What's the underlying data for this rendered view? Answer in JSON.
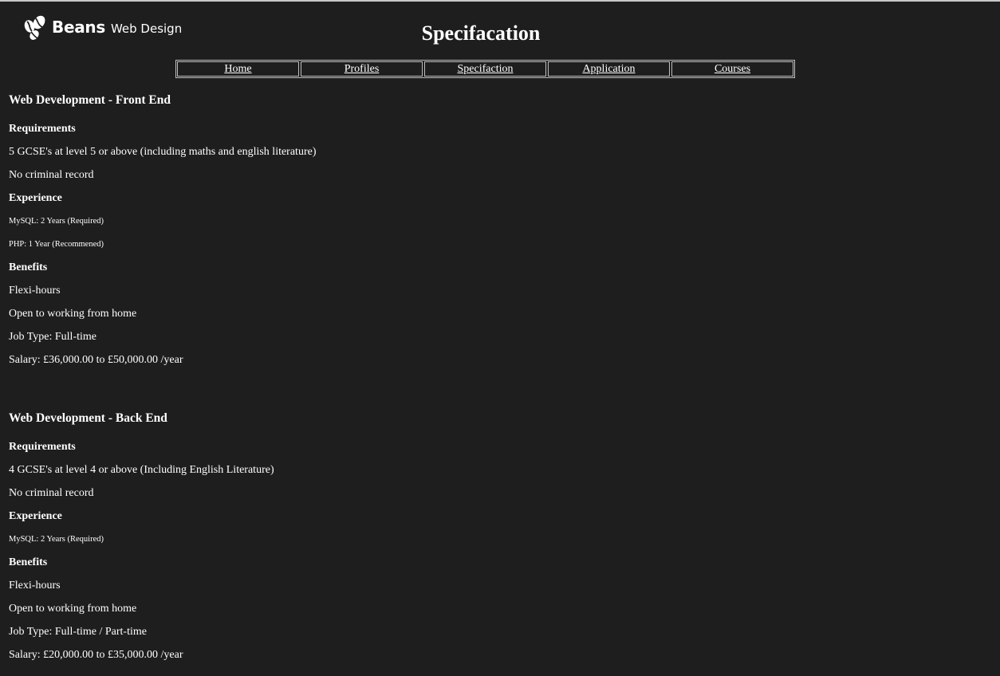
{
  "logo": {
    "brand": "Beans",
    "sub": "Web Design"
  },
  "page": {
    "title": "Specifacation"
  },
  "nav": [
    {
      "label": "Home"
    },
    {
      "label": "Profiles"
    },
    {
      "label": "Specifaction"
    },
    {
      "label": "Application"
    },
    {
      "label": "Courses"
    }
  ],
  "sections": [
    {
      "title": "Web Development - Front End",
      "requirements_label": "Requirements",
      "requirements": [
        "5 GCSE's at level 5 or above (including maths and english literature)",
        "No criminal record"
      ],
      "experience_label": "Experience",
      "experience": [
        "MySQL: 2 Years (Required)",
        "PHP: 1 Year (Recommened)"
      ],
      "benefits_label": "Benefits",
      "benefits": [
        "Flexi-hours",
        "Open to working from home"
      ],
      "job_type": "Job Type: Full-time",
      "salary": "Salary: £36,000.00 to £50,000.00 /year"
    },
    {
      "title": "Web Development - Back End",
      "requirements_label": "Requirements",
      "requirements": [
        "4 GCSE's at level 4 or above (Including English Literature)",
        "No criminal record"
      ],
      "experience_label": "Experience",
      "experience": [
        "MySQL: 2 Years (Required)"
      ],
      "benefits_label": "Benefits",
      "benefits": [
        "Flexi-hours",
        "Open to working from home"
      ],
      "job_type": "Job Type: Full-time / Part-time",
      "salary": "Salary: £20,000.00 to £35,000.00 /year"
    }
  ]
}
